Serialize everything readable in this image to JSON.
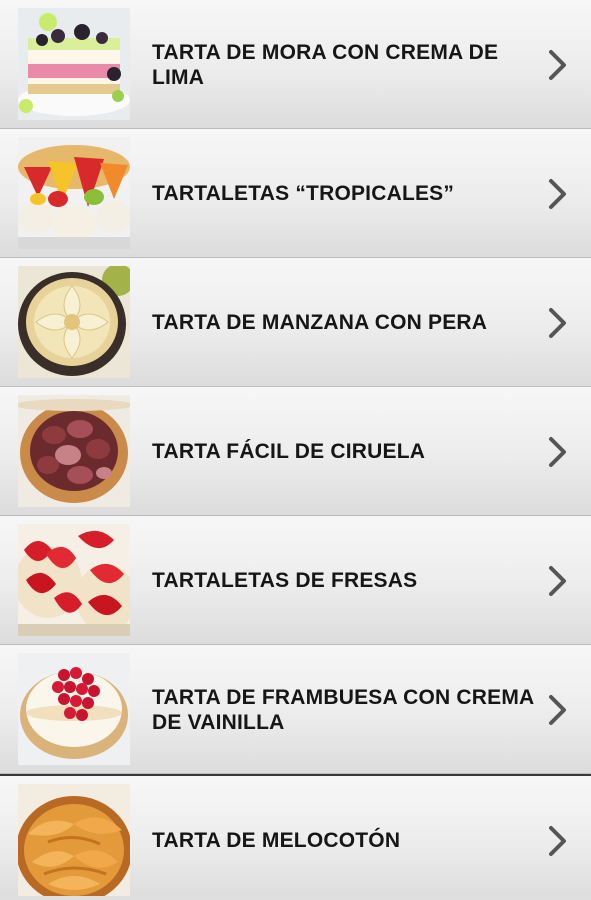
{
  "recipes": [
    {
      "title": "TARTA DE MORA CON CREMA DE LIMA",
      "image": "blackberry-lime-cake-photo"
    },
    {
      "title": "TARTALETAS “TROPICALES”",
      "image": "tropical-tartlets-photo"
    },
    {
      "title": "TARTA DE MANZANA CON PERA",
      "image": "apple-pear-tart-photo"
    },
    {
      "title": "TARTA FÁCIL DE CIRUELA",
      "image": "plum-tart-photo"
    },
    {
      "title": "TARTALETAS DE FRESAS",
      "image": "strawberry-tartlets-photo"
    },
    {
      "title": "TARTA DE FRAMBUESA CON CREMA DE VAINILLA",
      "image": "raspberry-vanilla-tart-photo"
    },
    {
      "title": "TARTA DE MELOCOTÓN",
      "image": "peach-tart-photo"
    }
  ],
  "chevron_icon": "chevron-right-icon",
  "colors": {
    "text": "#161616",
    "chevron": "#555555",
    "row_top": "#f7f7f7",
    "row_bottom": "#dcdcdc"
  }
}
